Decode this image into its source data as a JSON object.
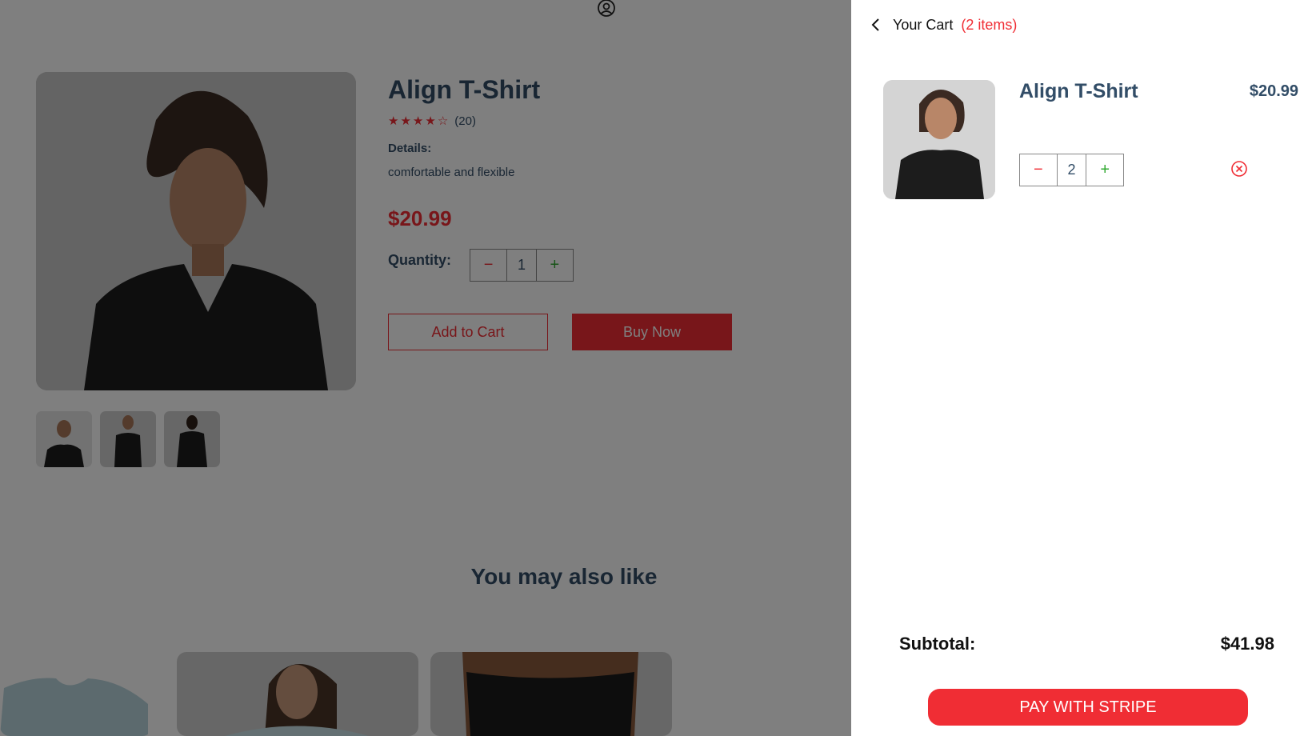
{
  "product": {
    "title": "Align T-Shirt",
    "rating_value": 4,
    "rating_max": 5,
    "review_count": "(20)",
    "details_label": "Details:",
    "details_text": "comfortable and flexible",
    "price": "$20.99",
    "quantity_label": "Quantity:",
    "quantity": "1",
    "minus_symbol": "−",
    "plus_symbol": "+",
    "add_to_cart_label": "Add to Cart",
    "buy_now_label": "Buy Now",
    "thumbnail_count": 3
  },
  "recommendations": {
    "heading": "You may also like"
  },
  "cart": {
    "heading": "Your Cart",
    "item_count_text": "(2 items)",
    "items": [
      {
        "name": "Align T-Shirt",
        "price": "$20.99",
        "quantity": "2",
        "minus_symbol": "−",
        "plus_symbol": "+"
      }
    ],
    "subtotal_label": "Subtotal:",
    "subtotal_value": "$41.98",
    "pay_button_label": "PAY WITH STRIPE"
  },
  "icons": {
    "user": "user-circle-icon",
    "back": "chevron-left-icon",
    "remove": "close-circle-icon",
    "star": "star-icon"
  },
  "colors": {
    "accent": "#f02d34",
    "text_primary": "#324d67",
    "plus_green": "#31a831",
    "overlay": "rgba(0,0,0,0.5)"
  }
}
